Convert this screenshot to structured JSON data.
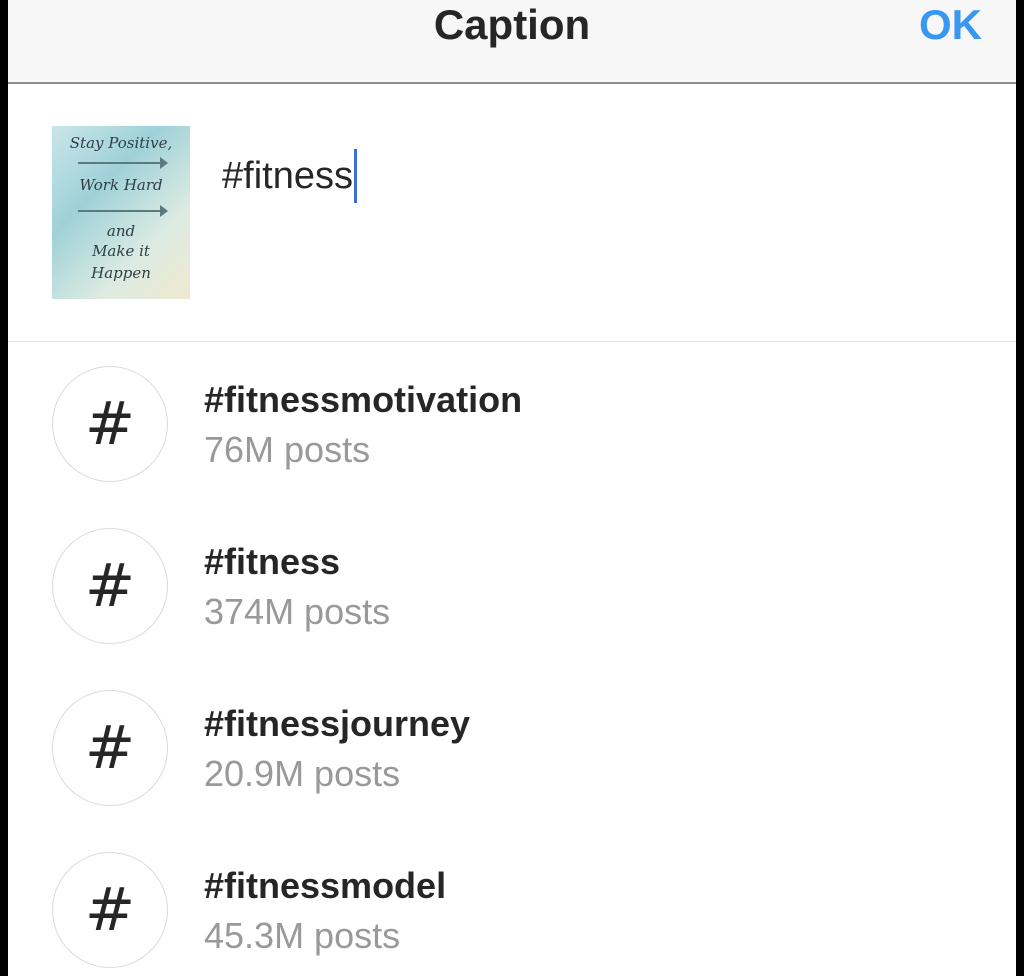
{
  "header": {
    "title": "Caption",
    "ok_label": "OK",
    "ok_color": "#3897f0"
  },
  "caption": {
    "value": "#fitness",
    "thumbnail_text": [
      "Stay Positive,",
      "Work Hard",
      "and",
      "Make it",
      "Happen"
    ]
  },
  "suggestions": [
    {
      "tag": "#fitnessmotivation",
      "count": "76M posts",
      "icon": "hashtag-icon"
    },
    {
      "tag": "#fitness",
      "count": "374M posts",
      "icon": "hashtag-icon"
    },
    {
      "tag": "#fitnessjourney",
      "count": "20.9M posts",
      "icon": "hashtag-icon"
    },
    {
      "tag": "#fitnessmodel",
      "count": "45.3M posts",
      "icon": "hashtag-icon"
    }
  ],
  "hash_symbol": "#",
  "colors": {
    "accent": "#3897f0",
    "cursor": "#3d6fd8",
    "secondary_text": "#999999"
  }
}
